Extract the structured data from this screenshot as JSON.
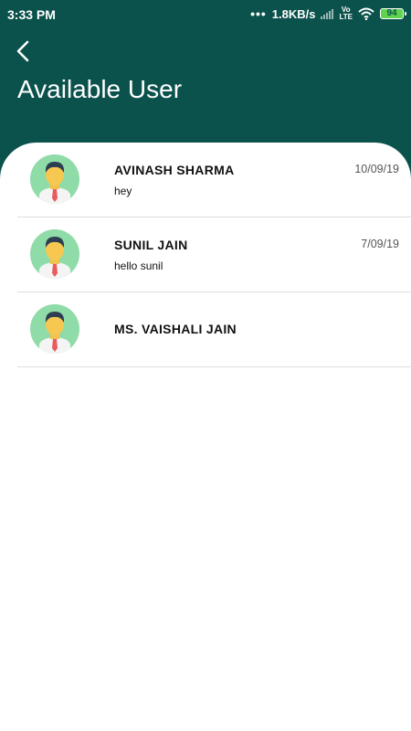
{
  "status_bar": {
    "time": "3:33 PM",
    "dots": "•••",
    "network_speed": "1.8KB/s",
    "volte": "Vo",
    "lte": "LTE",
    "battery": "94"
  },
  "header": {
    "title": "Available User"
  },
  "users": [
    {
      "name": "AVINASH SHARMA",
      "message": "hey",
      "date": "10/09/19"
    },
    {
      "name": "SUNIL JAIN",
      "message": "hello sunil",
      "date": "7/09/19"
    },
    {
      "name": "MS. VAISHALI JAIN",
      "message": "",
      "date": ""
    }
  ],
  "colors": {
    "header_bg": "#0b524c",
    "avatar_bg": "#8fdca8",
    "battery": "#5fd34e"
  },
  "icons": {
    "back": "chevron-left-icon",
    "avatar": "user-avatar-icon",
    "signal": "signal-icon",
    "wifi": "wifi-icon",
    "battery": "battery-icon"
  }
}
